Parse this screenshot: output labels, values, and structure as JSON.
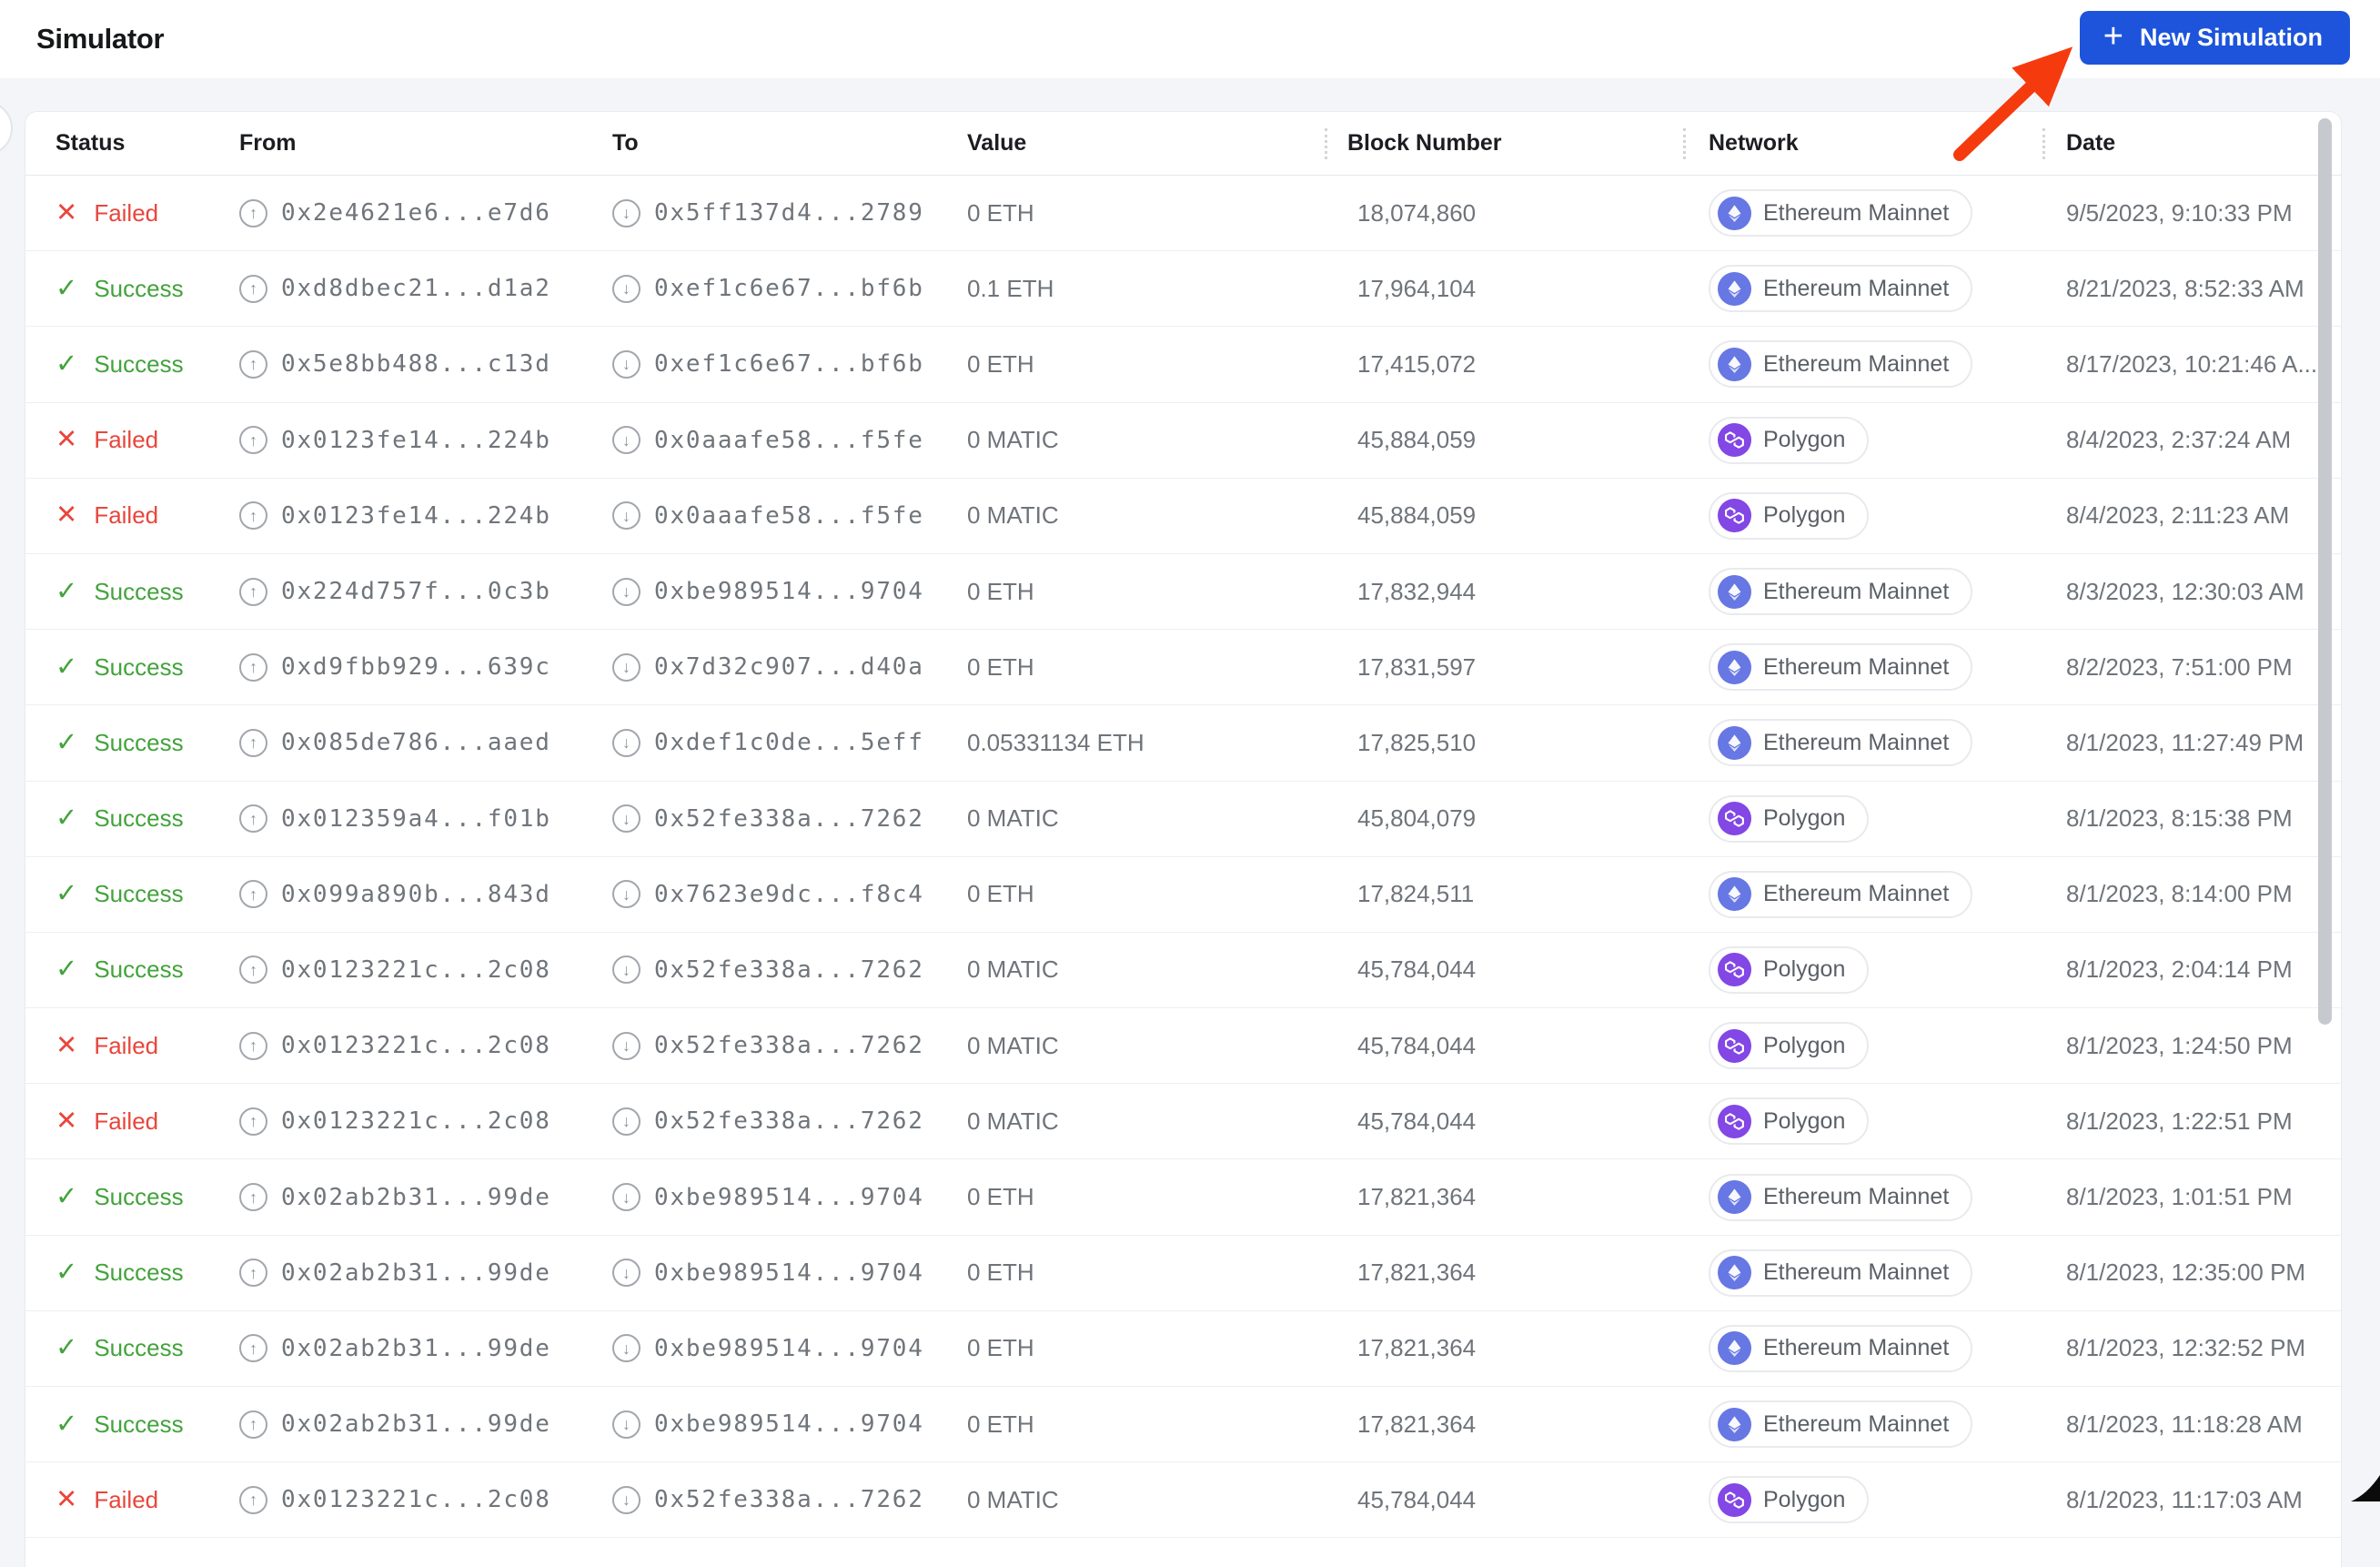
{
  "page": {
    "title": "Simulator"
  },
  "toolbar": {
    "new_simulation_label": "New Simulation",
    "plus_icon": "+"
  },
  "icons": {
    "success": "✓",
    "failed": "✕",
    "from_arrow": "↑",
    "to_arrow": "↓"
  },
  "colors": {
    "accent_blue": "#1d54db",
    "success_green": "#43a33c",
    "failed_red": "#e8463c",
    "ethereum_icon": "#6777e3",
    "polygon_icon": "#8247e5",
    "annotation_arrow_red": "#f53b0e"
  },
  "table": {
    "columns": [
      "Status",
      "From",
      "To",
      "Value",
      "Block Number",
      "Network",
      "Date"
    ],
    "rows": [
      {
        "status": "Failed",
        "from": "0x2e4621e6...e7d6",
        "to": "0x5ff137d4...2789",
        "value": "0 ETH",
        "block": "18,074,860",
        "network": "Ethereum Mainnet",
        "date": "9/5/2023, 9:10:33 PM"
      },
      {
        "status": "Success",
        "from": "0xd8dbec21...d1a2",
        "to": "0xef1c6e67...bf6b",
        "value": "0.1 ETH",
        "block": "17,964,104",
        "network": "Ethereum Mainnet",
        "date": "8/21/2023, 8:52:33 AM"
      },
      {
        "status": "Success",
        "from": "0x5e8bb488...c13d",
        "to": "0xef1c6e67...bf6b",
        "value": "0 ETH",
        "block": "17,415,072",
        "network": "Ethereum Mainnet",
        "date": "8/17/2023, 10:21:46 A..."
      },
      {
        "status": "Failed",
        "from": "0x0123fe14...224b",
        "to": "0x0aaafe58...f5fe",
        "value": "0 MATIC",
        "block": "45,884,059",
        "network": "Polygon",
        "date": "8/4/2023, 2:37:24 AM"
      },
      {
        "status": "Failed",
        "from": "0x0123fe14...224b",
        "to": "0x0aaafe58...f5fe",
        "value": "0 MATIC",
        "block": "45,884,059",
        "network": "Polygon",
        "date": "8/4/2023, 2:11:23 AM"
      },
      {
        "status": "Success",
        "from": "0x224d757f...0c3b",
        "to": "0xbe989514...9704",
        "value": "0 ETH",
        "block": "17,832,944",
        "network": "Ethereum Mainnet",
        "date": "8/3/2023, 12:30:03 AM"
      },
      {
        "status": "Success",
        "from": "0xd9fbb929...639c",
        "to": "0x7d32c907...d40a",
        "value": "0 ETH",
        "block": "17,831,597",
        "network": "Ethereum Mainnet",
        "date": "8/2/2023, 7:51:00 PM"
      },
      {
        "status": "Success",
        "from": "0x085de786...aaed",
        "to": "0xdef1c0de...5eff",
        "value": "0.05331134 ETH",
        "block": "17,825,510",
        "network": "Ethereum Mainnet",
        "date": "8/1/2023, 11:27:49 PM"
      },
      {
        "status": "Success",
        "from": "0x012359a4...f01b",
        "to": "0x52fe338a...7262",
        "value": "0 MATIC",
        "block": "45,804,079",
        "network": "Polygon",
        "date": "8/1/2023, 8:15:38 PM"
      },
      {
        "status": "Success",
        "from": "0x099a890b...843d",
        "to": "0x7623e9dc...f8c4",
        "value": "0 ETH",
        "block": "17,824,511",
        "network": "Ethereum Mainnet",
        "date": "8/1/2023, 8:14:00 PM"
      },
      {
        "status": "Success",
        "from": "0x0123221c...2c08",
        "to": "0x52fe338a...7262",
        "value": "0 MATIC",
        "block": "45,784,044",
        "network": "Polygon",
        "date": "8/1/2023, 2:04:14 PM"
      },
      {
        "status": "Failed",
        "from": "0x0123221c...2c08",
        "to": "0x52fe338a...7262",
        "value": "0 MATIC",
        "block": "45,784,044",
        "network": "Polygon",
        "date": "8/1/2023, 1:24:50 PM"
      },
      {
        "status": "Failed",
        "from": "0x0123221c...2c08",
        "to": "0x52fe338a...7262",
        "value": "0 MATIC",
        "block": "45,784,044",
        "network": "Polygon",
        "date": "8/1/2023, 1:22:51 PM"
      },
      {
        "status": "Success",
        "from": "0x02ab2b31...99de",
        "to": "0xbe989514...9704",
        "value": "0 ETH",
        "block": "17,821,364",
        "network": "Ethereum Mainnet",
        "date": "8/1/2023, 1:01:51 PM"
      },
      {
        "status": "Success",
        "from": "0x02ab2b31...99de",
        "to": "0xbe989514...9704",
        "value": "0 ETH",
        "block": "17,821,364",
        "network": "Ethereum Mainnet",
        "date": "8/1/2023, 12:35:00 PM"
      },
      {
        "status": "Success",
        "from": "0x02ab2b31...99de",
        "to": "0xbe989514...9704",
        "value": "0 ETH",
        "block": "17,821,364",
        "network": "Ethereum Mainnet",
        "date": "8/1/2023, 12:32:52 PM"
      },
      {
        "status": "Success",
        "from": "0x02ab2b31...99de",
        "to": "0xbe989514...9704",
        "value": "0 ETH",
        "block": "17,821,364",
        "network": "Ethereum Mainnet",
        "date": "8/1/2023, 11:18:28 AM"
      },
      {
        "status": "Failed",
        "from": "0x0123221c...2c08",
        "to": "0x52fe338a...7262",
        "value": "0 MATIC",
        "block": "45,784,044",
        "network": "Polygon",
        "date": "8/1/2023, 11:17:03 AM"
      }
    ]
  }
}
